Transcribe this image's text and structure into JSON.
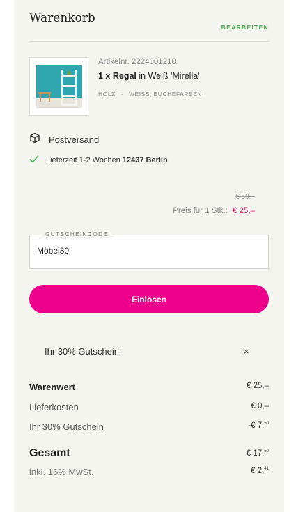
{
  "header": {
    "title": "Warenkorb",
    "edit_label": "BEARBEITEN"
  },
  "product": {
    "article_no": "Artikelnr. 2224001210",
    "quantity_name": "1 x Regal",
    "suffix": "in Weiß 'Mirella'",
    "tags": [
      "HOLZ",
      "·",
      "WEISS, BUCHEFARBEN"
    ],
    "image_icon": "shelf-product-image"
  },
  "shipping": {
    "label": "Postversand",
    "icon": "package-icon",
    "delivery_text": "Lieferzeit 1-2 Wochen",
    "location": "12437 Berlin",
    "check_color": "#4caf50"
  },
  "pricing": {
    "old_price": "€ 59,–",
    "unit_label": "Preis für 1 Stk.:",
    "new_price": "€ 25,–",
    "sale_color": "#e6186e"
  },
  "voucher": {
    "legend": "GUTSCHEINCODE",
    "value": "Möbel30",
    "button_label": "Einlösen",
    "button_color": "#ec008c",
    "applied_label": "Ihr 30% Gutschein",
    "remove_label": "×"
  },
  "summary": {
    "goods_label": "Warenwert",
    "goods_value": "€ 25,–",
    "delivery_label": "Lieferkosten",
    "delivery_value": "€ 0,–",
    "voucher_label": "Ihr 30% Gutschein",
    "voucher_value": "-€ 7,",
    "voucher_cents": "50",
    "total_label": "Gesamt",
    "total_value": "€ 17,",
    "total_cents": "50",
    "vat_label": "inkl. 16% MwSt.",
    "vat_value": "€ 2,",
    "vat_cents": "41"
  }
}
